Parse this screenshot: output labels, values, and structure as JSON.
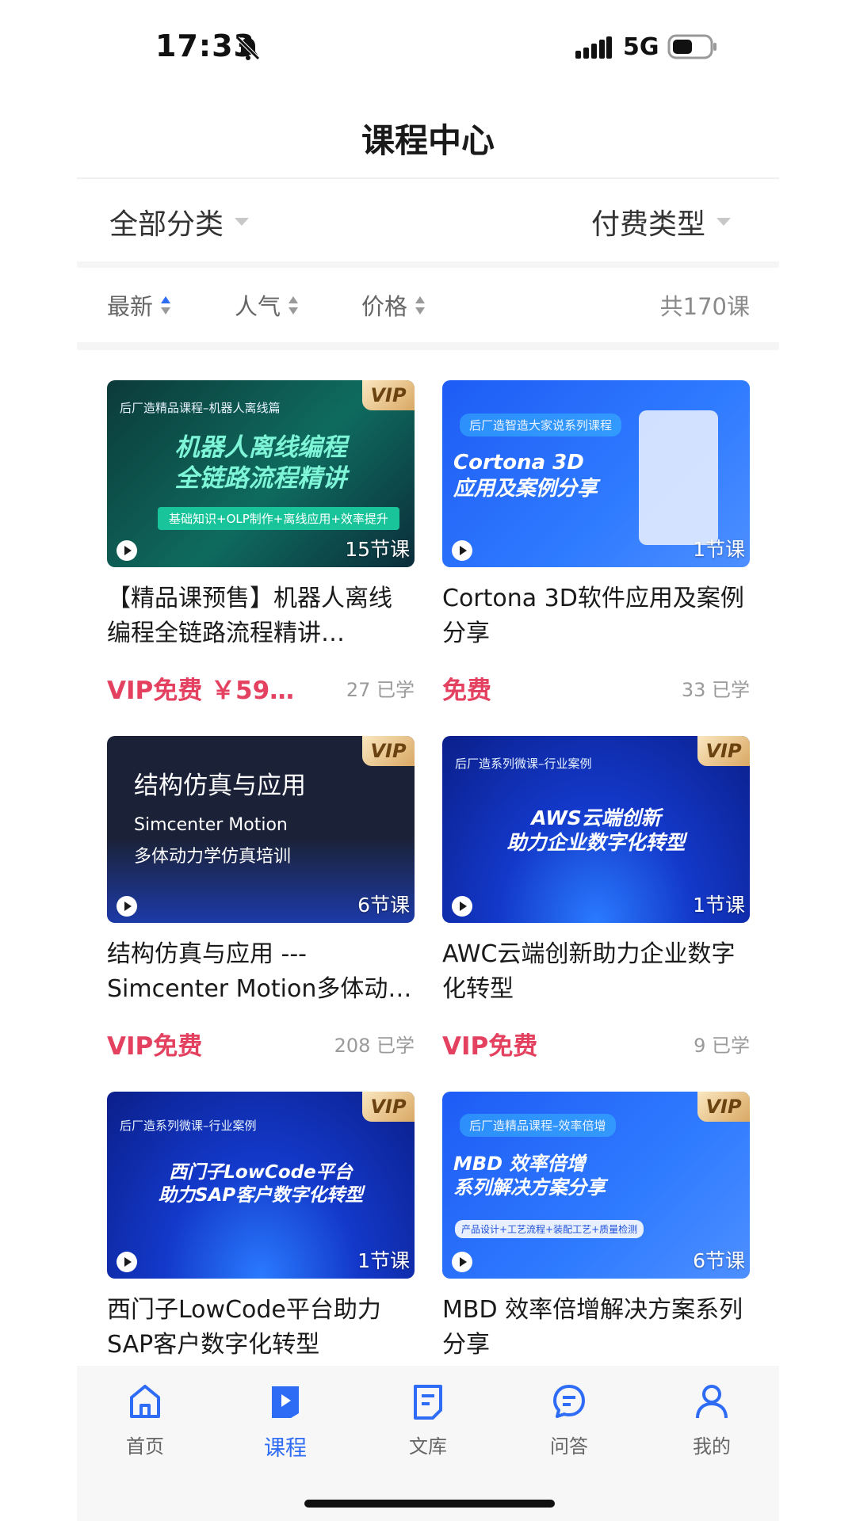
{
  "status_bar": {
    "time": "17:33",
    "network": "5G"
  },
  "header": {
    "title": "课程中心"
  },
  "filters": {
    "category": "全部分类",
    "pay_type": "付费类型"
  },
  "sort": {
    "latest": "最新",
    "popular": "人气",
    "price": "价格",
    "total": "共170课",
    "active": "latest"
  },
  "courses": [
    {
      "title": "【精品课预售】机器人离线编程全链路流程精讲…",
      "lessons": "15节课",
      "price": "VIP免费 ￥59…",
      "learned": "27 已学",
      "vip": "VIP",
      "banner_tag": "后厂造精品课程–机器人离线篇",
      "banner_title": "机器人离线编程\n全链路流程精讲",
      "banner_sub": "基础知识+OLP制作+离线应用+效率提升"
    },
    {
      "title": "Cortona 3D软件应用及案例分享",
      "lessons": "1节课",
      "price": "免费",
      "learned": "33 已学",
      "banner_tag": "后厂造智造大家说系列课程",
      "banner_title": "Cortona 3D\n应用及案例分享"
    },
    {
      "title": "结构仿真与应用 ---Simcenter Motion多体动力学…",
      "lessons": "6节课",
      "price": "VIP免费",
      "learned": "208 已学",
      "vip": "VIP",
      "banner_title": "结构仿真与应用",
      "banner_sub": "Simcenter Motion",
      "banner_sub2": "多体动力学仿真培训"
    },
    {
      "title": "AWC云端创新助力企业数字化转型",
      "lessons": "1节课",
      "price": "VIP免费",
      "learned": "9 已学",
      "vip": "VIP",
      "banner_tag": "后厂造系列微课–行业案例",
      "banner_title": "AWS云端创新\n助力企业数字化转型"
    },
    {
      "title": "西门子LowCode平台助力SAP客户数字化转型",
      "lessons": "1节课",
      "vip": "VIP",
      "banner_tag": "后厂造系列微课–行业案例",
      "banner_title": "西门子LowCode平台\n助力SAP客户数字化转型"
    },
    {
      "title": "MBD 效率倍增解决方案系列分享",
      "lessons": "6节课",
      "vip": "VIP",
      "banner_tag": "后厂造精品课程–效率倍增",
      "banner_title": "MBD 效率倍增\n系列解决方案分享",
      "banner_sub": "产品设计+工艺流程+装配工艺+质量检测"
    }
  ],
  "tabs": [
    {
      "label": "首页",
      "icon": "home-icon"
    },
    {
      "label": "课程",
      "icon": "play-course-icon",
      "active": true
    },
    {
      "label": "文库",
      "icon": "document-icon"
    },
    {
      "label": "问答",
      "icon": "chat-icon"
    },
    {
      "label": "我的",
      "icon": "user-icon"
    }
  ],
  "colors": {
    "accent": "#2e6cf6",
    "price": "#e4405f"
  }
}
